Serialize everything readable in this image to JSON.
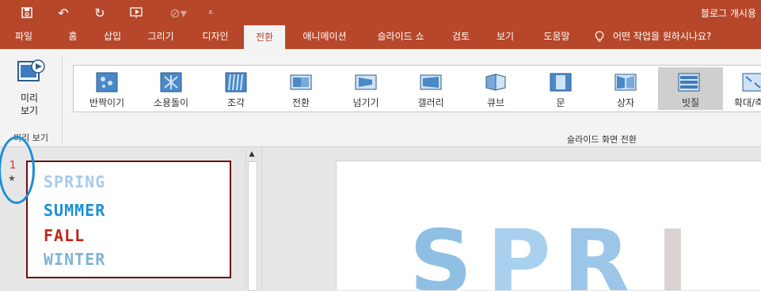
{
  "titlebar": {
    "doc_title": "블로그 개시용",
    "quick_access": [
      "save-icon",
      "undo-icon",
      "redo-icon",
      "start-from-beginning-icon",
      "touch-mode-icon",
      "customize-qat-icon"
    ]
  },
  "tabs": [
    {
      "label": "파일"
    },
    {
      "label": "홈"
    },
    {
      "label": "삽입"
    },
    {
      "label": "그리기"
    },
    {
      "label": "디자인"
    },
    {
      "label": "전환"
    },
    {
      "label": "애니메이션"
    },
    {
      "label": "슬라이드 쇼"
    },
    {
      "label": "검토"
    },
    {
      "label": "보기"
    },
    {
      "label": "도움말"
    }
  ],
  "tell_me": {
    "text": "어떤 작업을 원하시나요?",
    "icon": "lightbulb-icon"
  },
  "active_tab": "전환",
  "preview": {
    "label": "미리\n보기",
    "group_label": "미리 보기"
  },
  "gallery": {
    "group_label": "슬라이드 화면 전환",
    "items": [
      {
        "label": "반짝이기"
      },
      {
        "label": "소용돌이"
      },
      {
        "label": "조각"
      },
      {
        "label": "전환"
      },
      {
        "label": "넘기기"
      },
      {
        "label": "갤러리"
      },
      {
        "label": "큐브"
      },
      {
        "label": "문"
      },
      {
        "label": "상자"
      },
      {
        "label": "빗질"
      },
      {
        "label": "확대/축"
      }
    ],
    "selected": "빗질"
  },
  "slides_panel": {
    "slide_number": "1",
    "transition_marker": "★",
    "thumb_lines": [
      "SPRING",
      "SUMMER",
      "FALL",
      "WINTER"
    ]
  },
  "main_slide": {
    "letters": [
      "S",
      "P",
      "R",
      "I"
    ]
  },
  "colors": {
    "brand": "#b7472a",
    "highlight_circle": "#1a8fd6",
    "thumb_border": "#6b0e10"
  }
}
